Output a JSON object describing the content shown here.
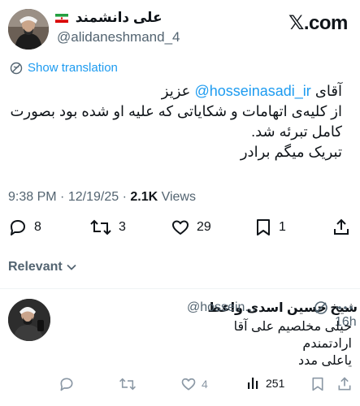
{
  "header": {
    "display_name": "علی دانشمند",
    "handle": "@alidaneshmand_4",
    "brand": "𝕏.com",
    "flag_colors": [
      "#239f40",
      "#ffffff",
      "#da0000"
    ]
  },
  "translate": {
    "label": "Show translation",
    "icon": "globe-icon"
  },
  "tweet": {
    "line1_prefix": "آقای",
    "mention": "@hosseinasadi_ir",
    "line1_suffix": "عزیز",
    "line2": "از کلیه‌ی اتهامات و شکایاتی که علیه او شده بود  بصورت",
    "line3": "کامل تبرئه شد.",
    "line4": "تبریک میگم برادر"
  },
  "meta": {
    "time": "9:38 PM",
    "sep": "·",
    "date": "12/19/25",
    "views_count": "2.1K",
    "views_label": "Views"
  },
  "actions": {
    "replies": "8",
    "reposts": "3",
    "likes": "29",
    "bookmarks": "1",
    "icons": [
      "reply-icon",
      "repost-icon",
      "like-icon",
      "bookmark-icon",
      "share-icon"
    ]
  },
  "sort": {
    "label": "Relevant",
    "icon": "chevron-down-icon"
  },
  "reply": {
    "display_name": "شیخ حسین اسدی واعظ",
    "handle": "@hossein...",
    "time": "· 16h",
    "line1": "خیلی مخلصیم علی آقا",
    "line2": "ارادتمندم",
    "line3": "یاعلی مدد",
    "likes": "4",
    "views": "251"
  },
  "colors": {
    "accent": "#1d9bf0",
    "text": "#0f1419",
    "muted": "#536471"
  }
}
